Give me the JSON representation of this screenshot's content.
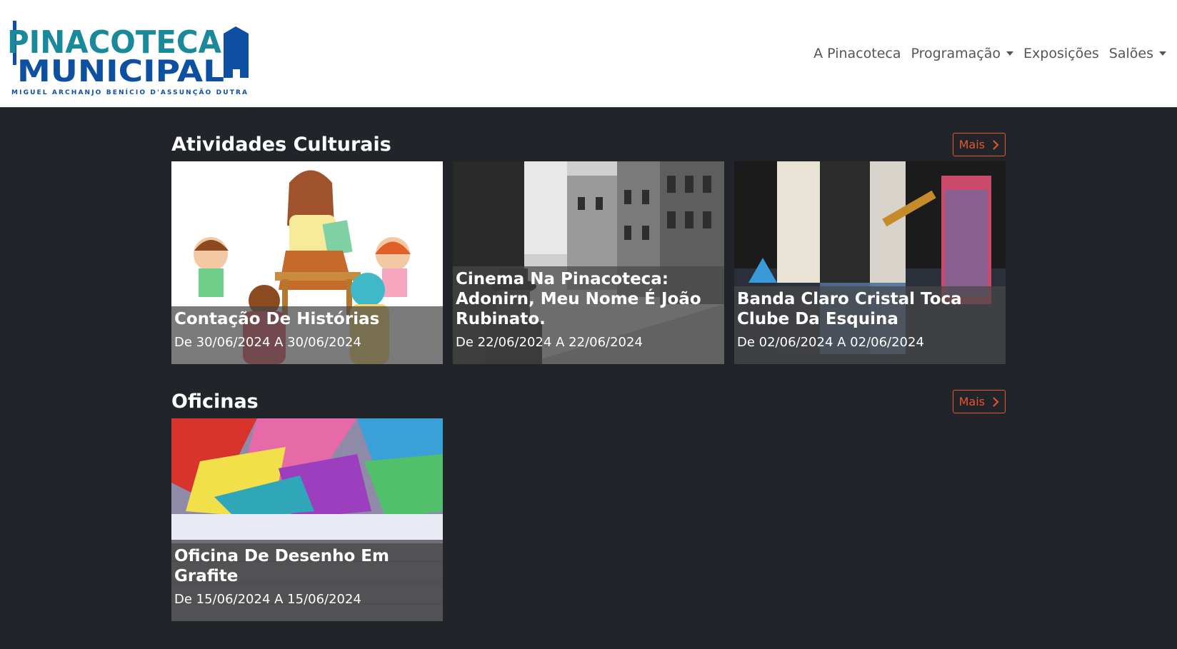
{
  "logo": {
    "line1": "PINACOTECA",
    "line2": "MUNICIPAL",
    "subtitle": "MIGUEL ARCHANJO BENÍCIO D'ASSUNÇÃO DUTRA"
  },
  "nav": {
    "items": [
      {
        "label": "A Pinacoteca",
        "dropdown": false
      },
      {
        "label": "Programação",
        "dropdown": true
      },
      {
        "label": "Exposições",
        "dropdown": false
      },
      {
        "label": "Salões",
        "dropdown": true
      }
    ]
  },
  "sections": [
    {
      "title": "Atividades Culturais",
      "more_label": "Mais",
      "cards": [
        {
          "title": "Contação De Histórias",
          "date": "De 30/06/2024 A 30/06/2024"
        },
        {
          "title": "Cinema Na Pinacoteca: Adonirn, Meu Nome É João Rubinato.",
          "date": "De 22/06/2024 A 22/06/2024"
        },
        {
          "title": "Banda Claro Cristal Toca Clube Da Esquina",
          "date": "De 02/06/2024 A 02/06/2024"
        }
      ]
    },
    {
      "title": "Oficinas",
      "more_label": "Mais",
      "cards": [
        {
          "title": "Oficina De Desenho Em Grafite",
          "date": "De 15/06/2024 A 15/06/2024"
        }
      ]
    }
  ],
  "colors": {
    "accent": "#e8552e",
    "logo_teal": "#1a8a9a",
    "logo_blue": "#0d4fa0",
    "background": "#212529"
  }
}
